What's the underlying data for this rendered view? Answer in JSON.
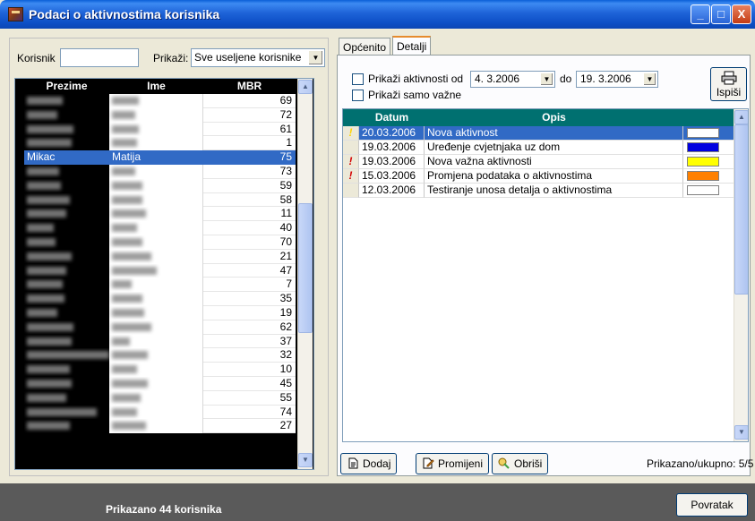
{
  "window": {
    "title": "Podaci o aktivnostima korisnika",
    "controls": {
      "minimize": "_",
      "maximize": "□",
      "close": "X"
    }
  },
  "left": {
    "korisnik_label": "Korisnik",
    "korisnik_value": "",
    "prikazi_label": "Prikaži:",
    "prikazi_value": "Sve useljene korisnike",
    "columns": {
      "prezime": "Prezime",
      "ime": "Ime",
      "mbr": "MBR"
    },
    "rows": [
      {
        "prezime": "",
        "ime": "",
        "mbr": "69"
      },
      {
        "prezime": "",
        "ime": "",
        "mbr": "72"
      },
      {
        "prezime": "",
        "ime": "",
        "mbr": "61"
      },
      {
        "prezime": "",
        "ime": "",
        "mbr": "1"
      },
      {
        "prezime": "Mikac",
        "ime": "Matija",
        "mbr": "75",
        "selected": true
      },
      {
        "prezime": "",
        "ime": "",
        "mbr": "73"
      },
      {
        "prezime": "",
        "ime": "",
        "mbr": "59"
      },
      {
        "prezime": "",
        "ime": "",
        "mbr": "58"
      },
      {
        "prezime": "",
        "ime": "",
        "mbr": "11"
      },
      {
        "prezime": "",
        "ime": "",
        "mbr": "40"
      },
      {
        "prezime": "",
        "ime": "",
        "mbr": "70"
      },
      {
        "prezime": "",
        "ime": "",
        "mbr": "21"
      },
      {
        "prezime": "",
        "ime": "",
        "mbr": "47"
      },
      {
        "prezime": "",
        "ime": "",
        "mbr": "7"
      },
      {
        "prezime": "",
        "ime": "",
        "mbr": "35"
      },
      {
        "prezime": "",
        "ime": "",
        "mbr": "19"
      },
      {
        "prezime": "",
        "ime": "",
        "mbr": "62"
      },
      {
        "prezime": "",
        "ime": "",
        "mbr": "37"
      },
      {
        "prezime": "",
        "ime": "",
        "mbr": "32"
      },
      {
        "prezime": "",
        "ime": "",
        "mbr": "10"
      },
      {
        "prezime": "",
        "ime": "",
        "mbr": "45"
      },
      {
        "prezime": "",
        "ime": "",
        "mbr": "55"
      },
      {
        "prezime": "",
        "ime": "",
        "mbr": "74"
      },
      {
        "prezime": "",
        "ime": "",
        "mbr": "27"
      }
    ]
  },
  "tabs": {
    "general": "Općenito",
    "details": "Detalji"
  },
  "filters": {
    "show_from_label": "Prikaži aktivnosti od",
    "date_from": "4. 3.2006",
    "to_label": "do",
    "date_to": "19. 3.2006",
    "important_only_label": "Prikaži samo važne",
    "print_label": "Ispiši"
  },
  "activities": {
    "columns": {
      "datum": "Datum",
      "opis": "Opis"
    },
    "rows": [
      {
        "flag": "!",
        "datum": "20.03.2006",
        "opis": "Nova aktivnost",
        "color": "#ffffff",
        "selected": true
      },
      {
        "flag": "",
        "datum": "19.03.2006",
        "opis": "Uređenje cvjetnjaka uz dom",
        "color": "#0000e0"
      },
      {
        "flag": "!",
        "datum": "19.03.2006",
        "opis": "Nova važna aktivnosti",
        "color": "#ffff00"
      },
      {
        "flag": "!",
        "datum": "15.03.2006",
        "opis": "Promjena podataka o aktivnostima",
        "color": "#ff8000"
      },
      {
        "flag": "",
        "datum": "12.03.2006",
        "opis": "Testiranje unosa detalja o aktivnostima",
        "color": "#ffffff"
      }
    ]
  },
  "actions": {
    "add": "Dodaj",
    "edit": "Promijeni",
    "delete": "Obriši",
    "count": "Prikazano/ukupno: 5/5"
  },
  "status": {
    "text": "Prikazano 44 korisnika",
    "back": "Povratak"
  }
}
